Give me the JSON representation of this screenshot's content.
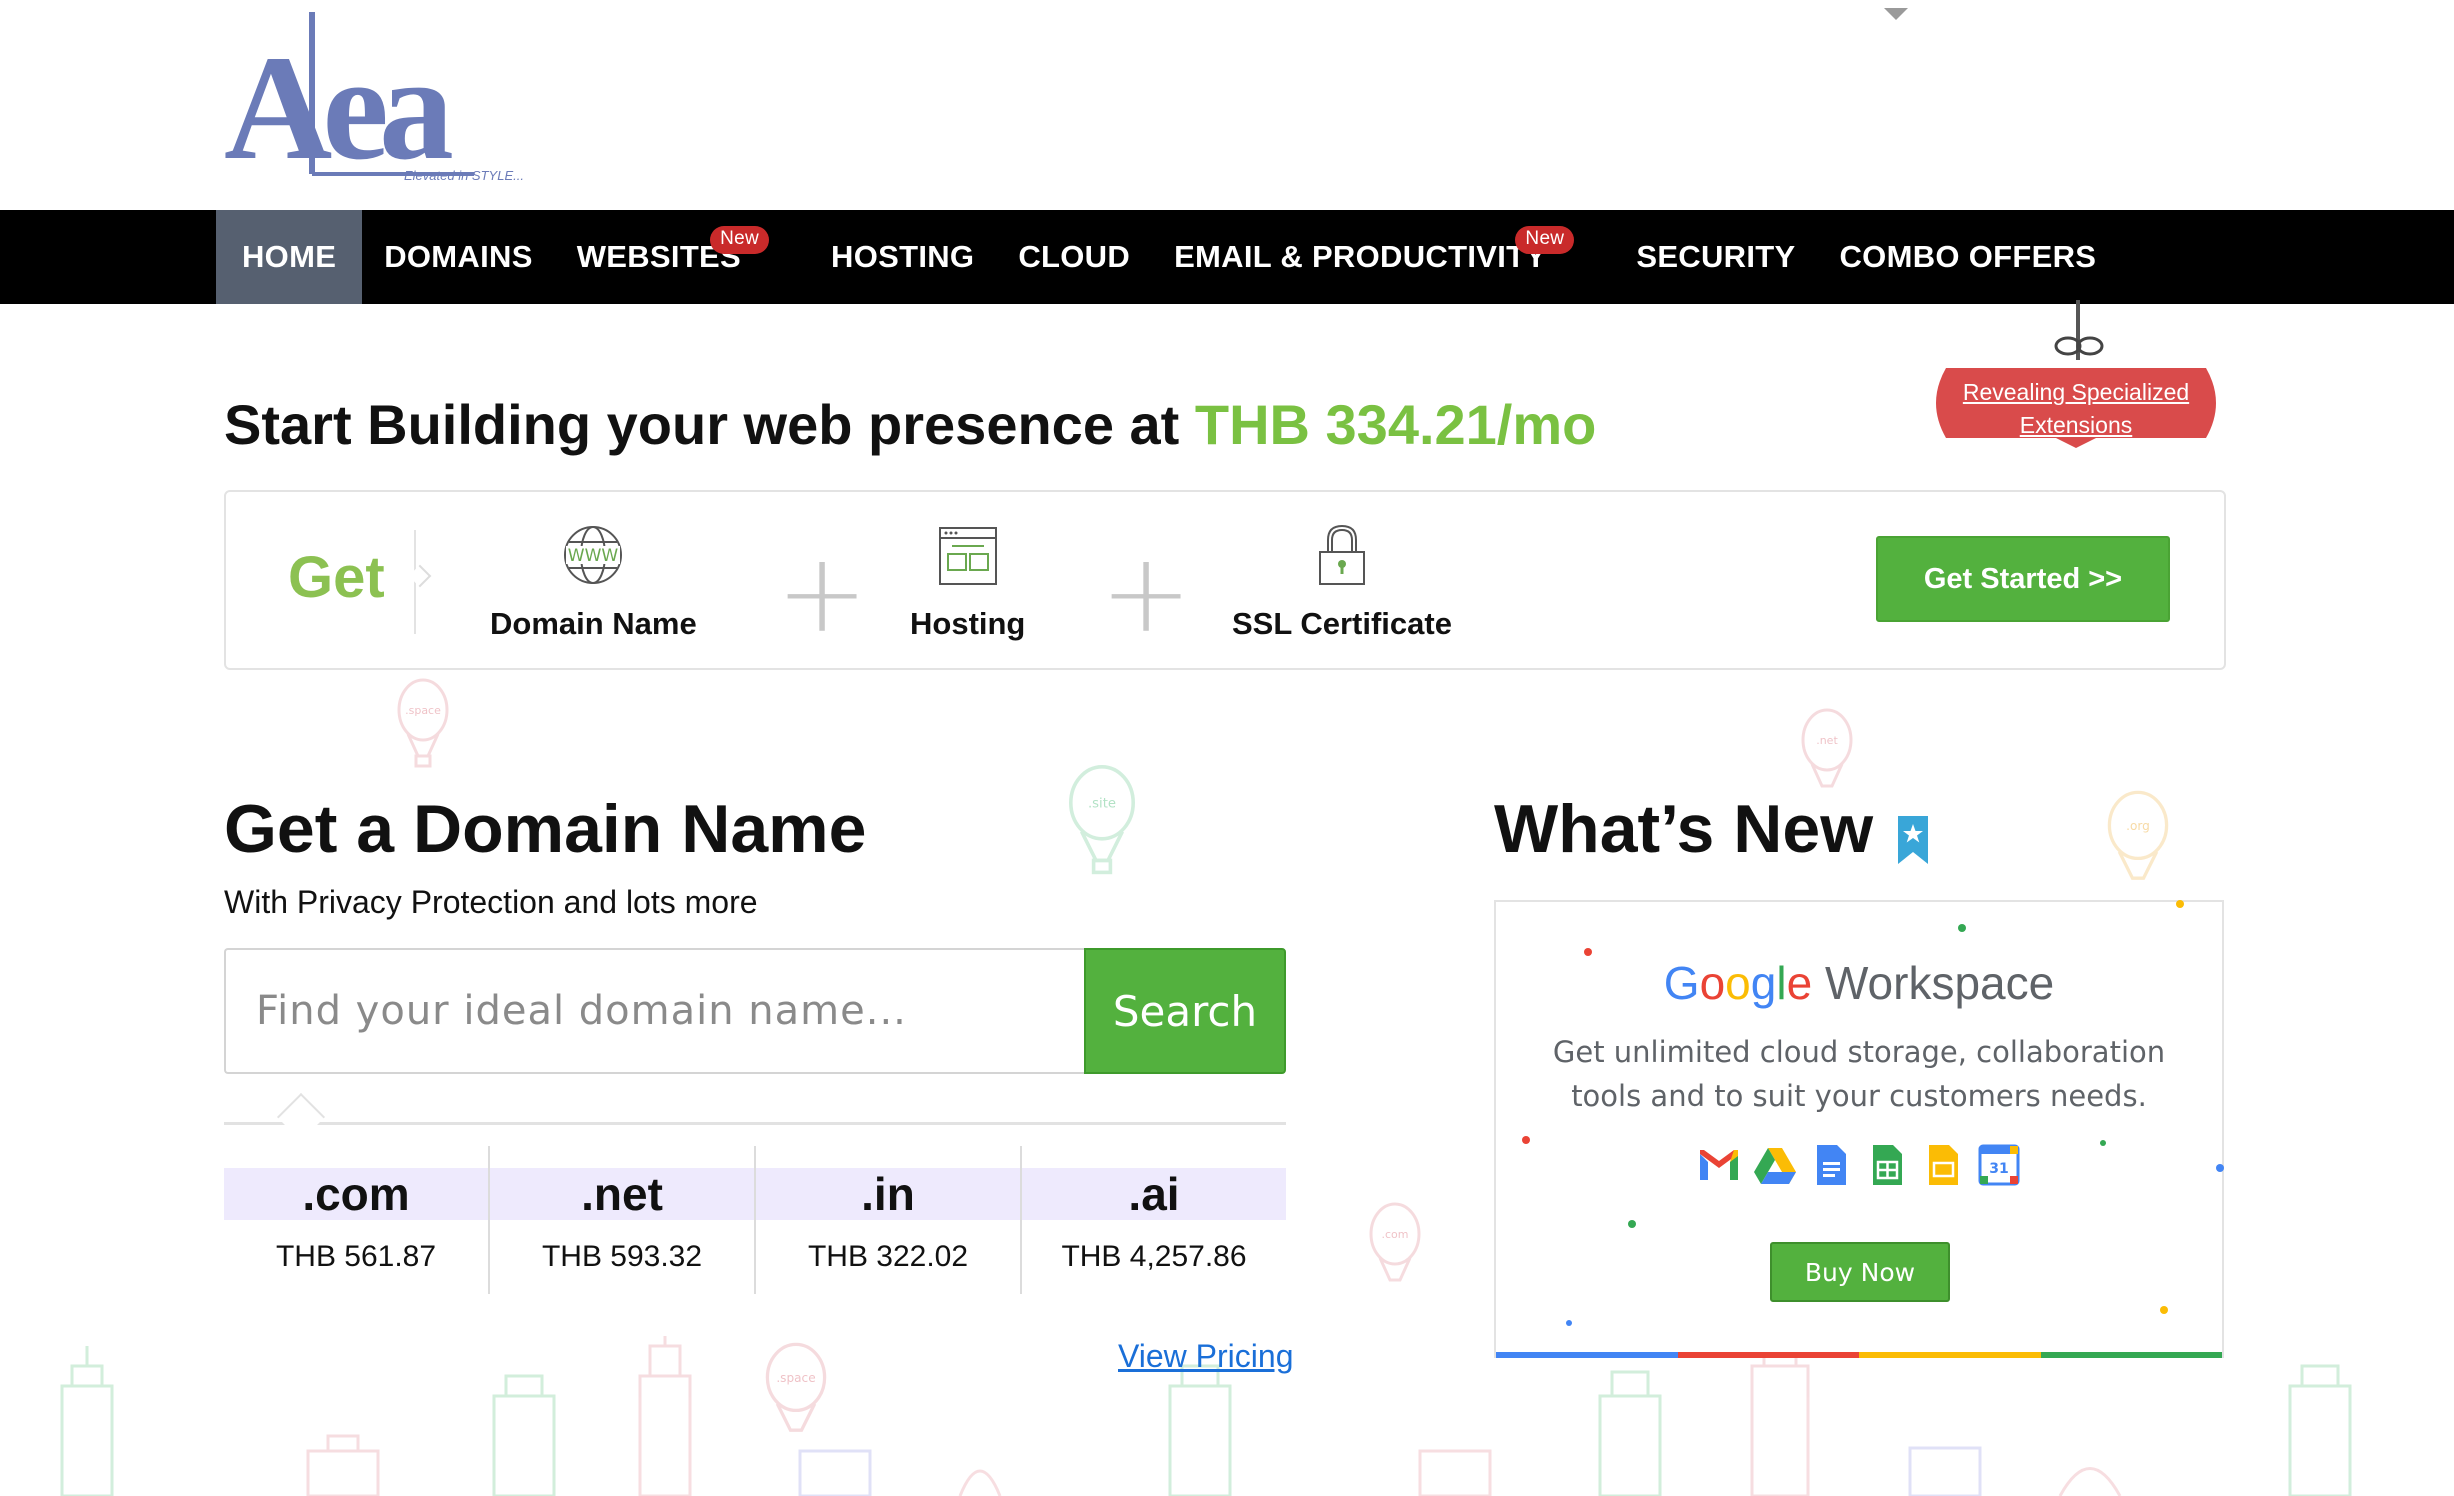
{
  "header": {
    "logo_text": "Aea",
    "logo_tagline": "Elevated in STYLE..."
  },
  "nav": {
    "items": [
      {
        "label": "HOME",
        "active": true
      },
      {
        "label": "DOMAINS"
      },
      {
        "label": "WEBSITES",
        "badge": "New"
      },
      {
        "label": "HOSTING"
      },
      {
        "label": "CLOUD"
      },
      {
        "label": "EMAIL & PRODUCTIVITY",
        "badge": "New"
      },
      {
        "label": "SECURITY"
      },
      {
        "label": "COMBO OFFERS"
      }
    ]
  },
  "promo": {
    "line1": "Revealing Specialized",
    "line2": "Extensions"
  },
  "headline": {
    "prefix": "Start Building your web presence at ",
    "price": "THB 334.21/mo"
  },
  "bundle": {
    "get_label": "Get",
    "items": [
      {
        "label": "Domain Name",
        "icon": "www-globe-icon"
      },
      {
        "label": "Hosting",
        "icon": "hosting-window-icon"
      },
      {
        "label": "SSL Certificate",
        "icon": "padlock-icon"
      }
    ],
    "plus_symbol": "+",
    "cta_label": "Get Started >>"
  },
  "domain_search": {
    "title": "Get a Domain Name",
    "subtitle": "With Privacy Protection and lots more",
    "placeholder": "Find your ideal domain name...",
    "button_label": "Search",
    "tlds": [
      {
        "name": ".com",
        "price": "THB 561.87"
      },
      {
        "name": ".net",
        "price": "THB 593.32"
      },
      {
        "name": ".in",
        "price": "THB 322.02"
      },
      {
        "name": ".ai",
        "price": "THB 4,257.86"
      }
    ],
    "view_pricing": "View Pricing"
  },
  "whats_new": {
    "title": "What’s New",
    "brand_google": [
      "G",
      "o",
      "o",
      "g",
      "l",
      "e"
    ],
    "brand_workspace": " Workspace",
    "description": "Get unlimited cloud storage, collaboration tools and to suit your customers needs.",
    "apps": [
      "gmail-icon",
      "drive-icon",
      "docs-icon",
      "sheets-icon",
      "slides-icon",
      "calendar-icon"
    ],
    "button_label": "Buy Now",
    "calendar_day": "31"
  },
  "balloons": [
    ".space",
    ".site",
    ".net",
    ".org",
    ".com",
    ".space"
  ],
  "colors": {
    "nav_bg": "#000000",
    "nav_active": "#566070",
    "brand_green": "#53b13e",
    "price_green": "#7ac142",
    "badge_red": "#c92a2a",
    "link_blue": "#1a6fd8",
    "tld_bg": "#eeeafd",
    "logo_blue": "#6b7bb8"
  }
}
